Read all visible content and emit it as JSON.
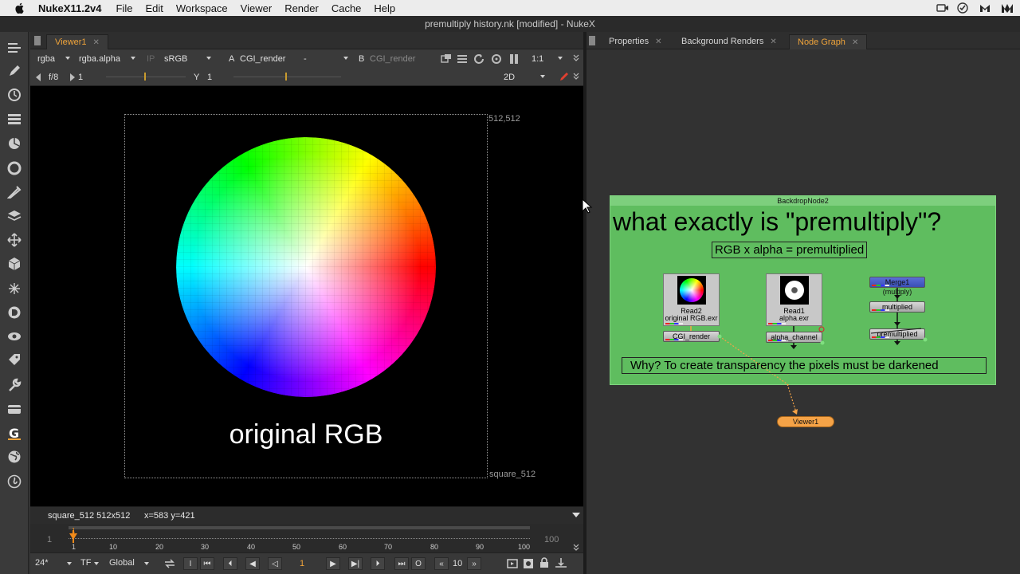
{
  "menubar": {
    "app": "NukeX11.2v4",
    "items": [
      "File",
      "Edit",
      "Workspace",
      "Viewer",
      "Render",
      "Cache",
      "Help"
    ]
  },
  "window_title": "premultiply history.nk [modified] - NukeX",
  "viewer": {
    "tab_label": "Viewer1",
    "channels": "rgba",
    "alpha_channel": "rgba.alpha",
    "ip_label": "IP",
    "colorspace": "sRGB",
    "a_label": "A",
    "a_input": "CGI_render",
    "op": "-",
    "b_label": "B",
    "b_input": "CGI_render",
    "zoom": "1:1",
    "fstop": "f/8",
    "gain": "1",
    "y_label": "Y",
    "gamma": "1",
    "view_mode": "2D",
    "format_label_top": "512,512",
    "format_label_bottom": "square_512",
    "caption": "original RGB",
    "status_format": "square_512 512x512",
    "status_coords": "x=583 y=421"
  },
  "timeline": {
    "start": "1",
    "end": "100",
    "ticks": [
      "1",
      "10",
      "20",
      "30",
      "40",
      "50",
      "60",
      "70",
      "80",
      "90",
      "100"
    ],
    "current_frame_marker": "1"
  },
  "transport": {
    "fps": "24*",
    "tf": "TF",
    "scope": "Global",
    "in_label": "I",
    "out_label": "O",
    "frame": "1",
    "increment": "10"
  },
  "right_panel": {
    "tabs": [
      "Properties",
      "Background Renders",
      "Node Graph"
    ],
    "active_tab": "Node Graph"
  },
  "node_graph": {
    "backdrop_label": "BackdropNode2",
    "backdrop_title": "what exactly is \"premultiply\"?",
    "formula": "RGB x alpha = premultiplied",
    "why": "Why? To create transparency the pixels must be darkened",
    "read2_name": "Read2",
    "read2_file": "original RGB.exr",
    "read1_name": "Read1",
    "read1_file": "alpha.exr",
    "cgi_render": "CGI_render",
    "alpha_channel": "alpha_channel",
    "merge": "Merge1 (multiply)",
    "multiplied": "multiplied",
    "premultiplied": "premultiplied",
    "viewer_node": "Viewer1"
  },
  "colors": {
    "accent_orange": "#f0a43a",
    "backdrop_green": "#5fbd5f",
    "viewer_node": "#f5a347"
  }
}
